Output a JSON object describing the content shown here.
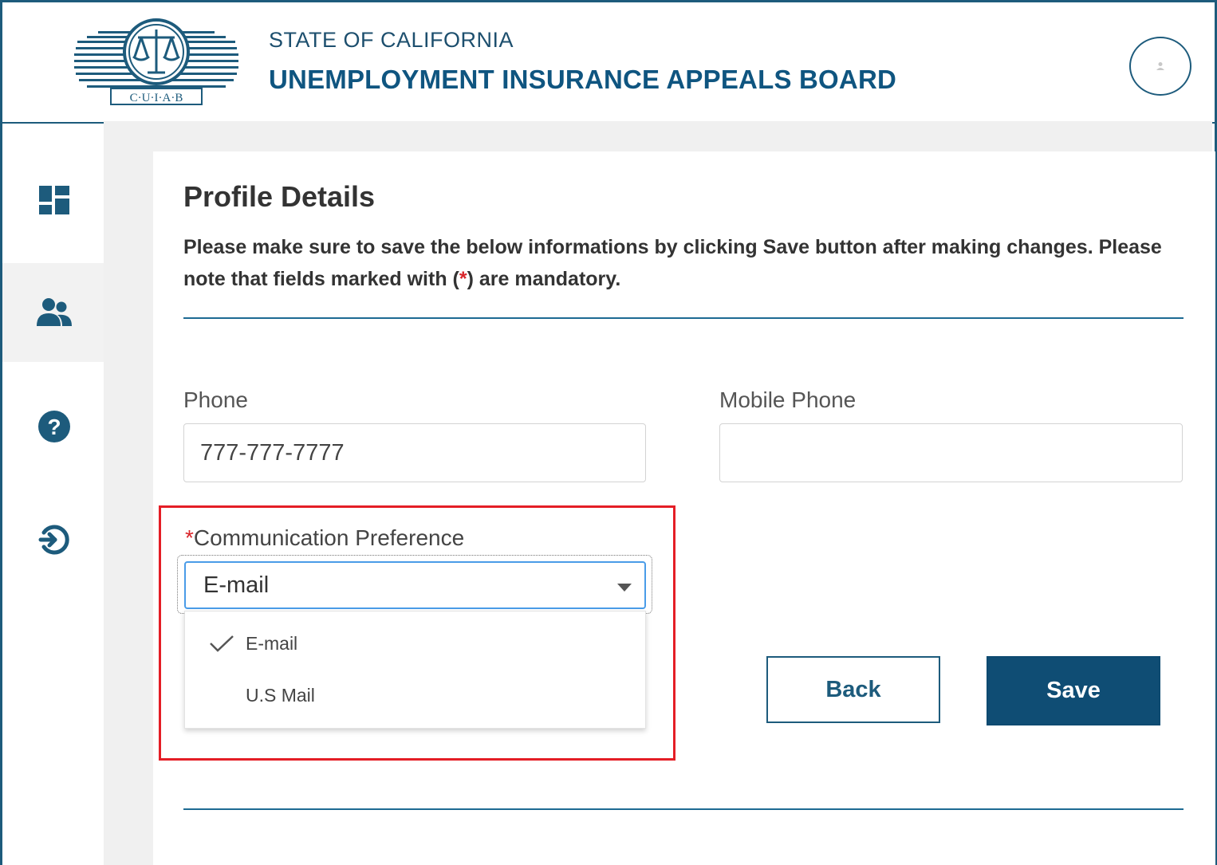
{
  "header": {
    "logo_text": "C·U·I·A·B",
    "org_state": "STATE OF CALIFORNIA",
    "org_name": "UNEMPLOYMENT INSURANCE APPEALS BOARD",
    "avatar_icon": "user-icon"
  },
  "sidebar": {
    "items": [
      {
        "icon": "dashboard-icon",
        "active": false
      },
      {
        "icon": "users-icon",
        "active": true
      },
      {
        "icon": "help-icon",
        "active": false
      },
      {
        "icon": "logout-icon",
        "active": false
      }
    ]
  },
  "page": {
    "title": "Profile Details",
    "note_before": "Please make sure to save the below informations by clicking Save button after making changes. Please note that fields marked with (",
    "note_star": "*",
    "note_after": ") are mandatory."
  },
  "form": {
    "phone_label": "Phone",
    "phone_value": "777-777-7777",
    "mobile_label": "Mobile Phone",
    "mobile_value": "",
    "comm_required_mark": "*",
    "comm_label": "Communication Preference",
    "comm_selected": "E-mail",
    "comm_options": [
      "E-mail",
      "U.S Mail"
    ]
  },
  "buttons": {
    "back": "Back",
    "save": "Save"
  },
  "colors": {
    "brand": "#0f4d74",
    "accent_blue": "#4a9ce8",
    "highlight_red": "#e41e26"
  }
}
